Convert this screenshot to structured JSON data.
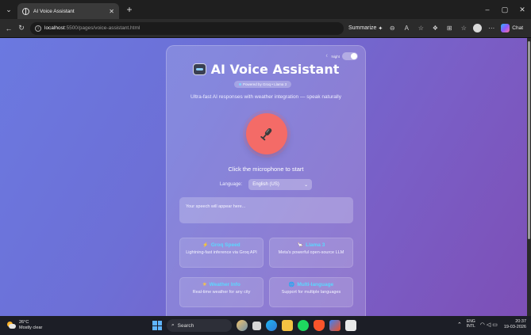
{
  "browser": {
    "tab_title": "AI Voice Assistant",
    "new_tab": "+",
    "url_host": "localhost",
    "url_path": ":5500/pages/voice-assistant.html",
    "summarize_label": "Summarize",
    "copilot_label": "Chat",
    "window_controls": [
      "–",
      "▢",
      "✕"
    ]
  },
  "app": {
    "night_label": "Night",
    "title": "AI Voice Assistant",
    "badge": "Powered by Groq • Llama 3",
    "subtitle": "Ultra-fast AI responses with weather integration — speak naturally",
    "mic_status": "Click the microphone to start",
    "language_label": "Language:",
    "language_value": "English (US)",
    "transcript_placeholder": "Your speech will appear here...",
    "features": [
      {
        "icon": "⚡",
        "title": "Groq Speed",
        "desc": "Lightning-fast inference via Groq API",
        "color": "#5ad7ff"
      },
      {
        "icon": "🦙",
        "title": "Llama 3",
        "desc": "Meta's powerful open-source LLM",
        "color": "#5ad7ff"
      },
      {
        "icon": "☀",
        "title": "Weather Info",
        "desc": "Real-time weather for any city",
        "color": "#5ad7ff"
      },
      {
        "icon": "🌐",
        "title": "Multi-language",
        "desc": "Support for multiple languages",
        "color": "#5ad7ff"
      }
    ],
    "colors": {
      "mic": "#f46b67",
      "accent": "#5ad7ff"
    }
  },
  "taskbar": {
    "temperature": "26°C",
    "condition": "Mostly clear",
    "search_label": "Search",
    "lang_top": "ENG",
    "lang_bottom": "INTL",
    "time": "20:37",
    "date": "19-03-2026"
  }
}
